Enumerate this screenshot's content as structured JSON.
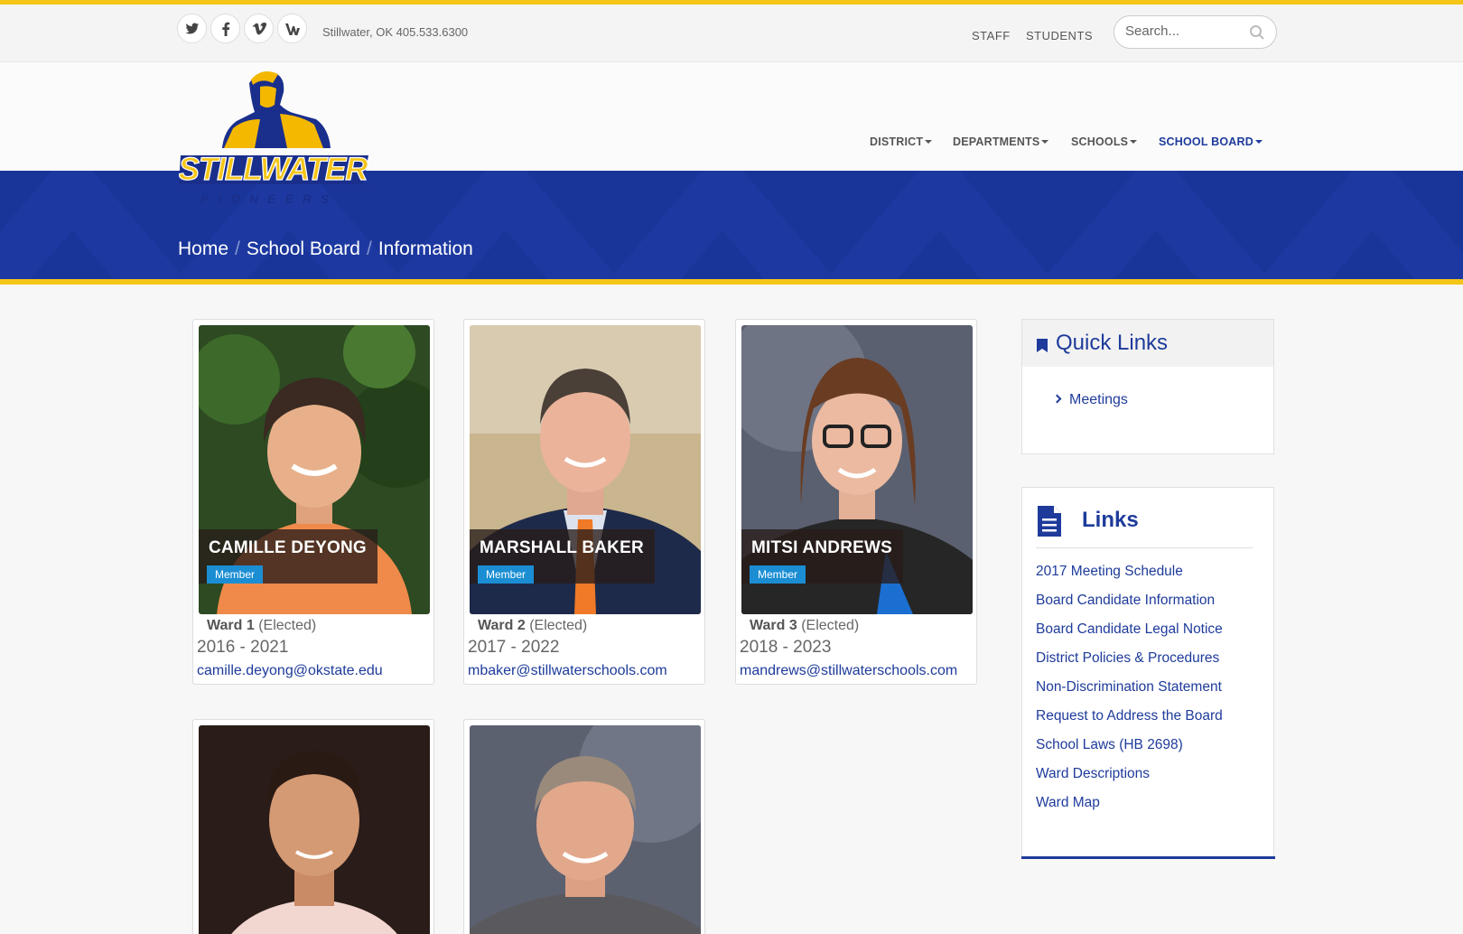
{
  "topbar": {
    "social": [
      {
        "icon": "twitter-icon",
        "glyph": "🐦"
      },
      {
        "icon": "facebook-icon",
        "glyph": "f"
      },
      {
        "icon": "vimeo-icon",
        "glyph": "v"
      },
      {
        "icon": "peachjar-icon",
        "glyph": "W"
      }
    ],
    "contact": "Stillwater, OK 405.533.6300",
    "links": [
      "STAFF",
      "STUDENTS"
    ],
    "search_placeholder": "Search..."
  },
  "logo": {
    "text": "STILLWATER",
    "subtext": "PIONEERS",
    "tm": "™"
  },
  "nav": {
    "items": [
      "DISTRICT",
      "DEPARTMENTS",
      "SCHOOLS",
      "SCHOOL BOARD"
    ],
    "active": "SCHOOL BOARD"
  },
  "breadcrumb": {
    "items": [
      "Home",
      "School Board",
      "Information"
    ],
    "separator": "/"
  },
  "members": [
    {
      "name": "CAMILLE DEYONG",
      "role": "Member",
      "ward": "Ward 1",
      "ward_note": "(Elected)",
      "years": "2016 - 2021",
      "email": "camille.deyong@okstate.edu"
    },
    {
      "name": "MARSHALL BAKER",
      "role": "Member",
      "ward": "Ward 2",
      "ward_note": "(Elected)",
      "years": "2017 - 2022",
      "email": "mbaker@stillwaterschools.com"
    },
    {
      "name": "MITSI ANDREWS",
      "role": "Member",
      "ward": "Ward 3",
      "ward_note": "(Elected)",
      "years": "2018 - 2023",
      "email": "mandrews@stillwaterschools.com"
    }
  ],
  "quick_links": {
    "title": "Quick Links",
    "items": [
      "Meetings"
    ]
  },
  "links": {
    "title": "Links",
    "items": [
      "2017 Meeting Schedule",
      "Board Candidate Information",
      "Board Candidate Legal Notice",
      "District Policies & Procedures",
      "Non-Discrimination Statement",
      "Request to Address the Board",
      "School Laws (HB 2698)",
      "Ward Descriptions",
      "Ward Map"
    ]
  },
  "colors": {
    "brand_blue": "#1a3599",
    "brand_gold": "#f5c518",
    "link_blue": "#1e3b9b",
    "badge_blue": "#1b8ed3"
  }
}
